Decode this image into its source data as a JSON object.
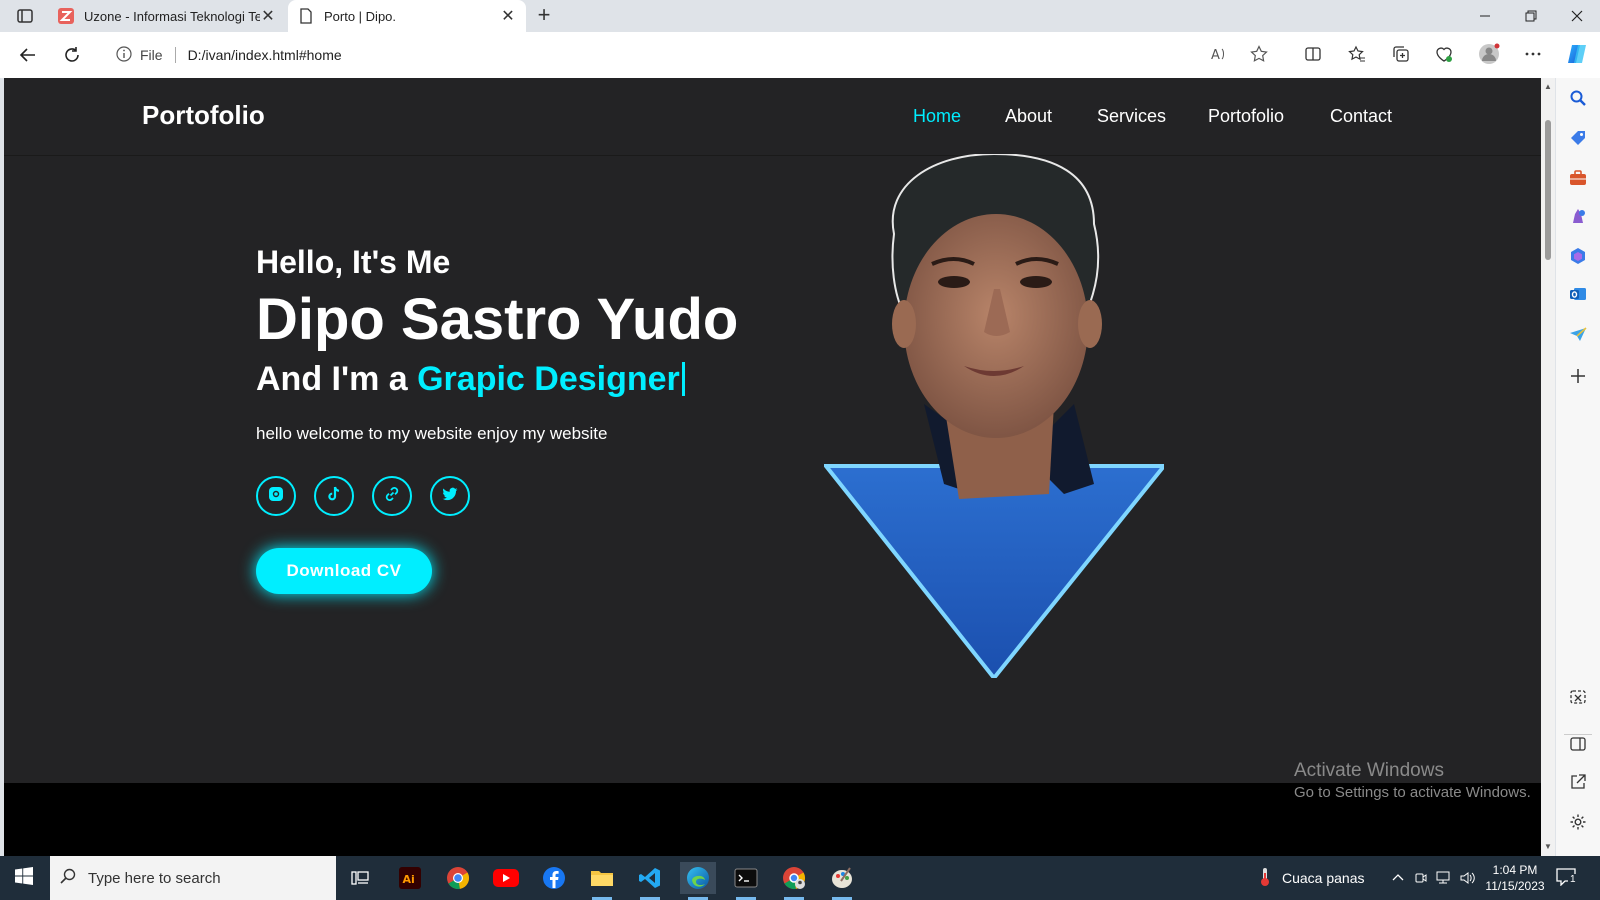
{
  "browser": {
    "tabs": [
      {
        "title": "Uzone - Informasi Teknologi Terk",
        "active": false
      },
      {
        "title": "Porto | Dipo.",
        "active": true
      }
    ],
    "address": {
      "scheme_label": "File",
      "url": "D:/ivan/index.html#home"
    }
  },
  "site": {
    "logo": "Portofolio",
    "nav": [
      {
        "label": "Home",
        "active": true
      },
      {
        "label": "About",
        "active": false
      },
      {
        "label": "Services",
        "active": false
      },
      {
        "label": "Portofolio",
        "active": false
      },
      {
        "label": "Contact",
        "active": false
      }
    ],
    "hero": {
      "greeting": "Hello, It's Me",
      "name": "Dipo Sastro Yudo",
      "role_prefix": "And I'm a",
      "role_highlight": "Grapic Designer",
      "tagline": "hello welcome to my website enjoy my website",
      "social_icons": [
        "instagram-icon",
        "tiktok-icon",
        "link-icon",
        "twitter-icon"
      ],
      "cta_label": "Download CV"
    },
    "accent_color": "#00eeff",
    "background_color": "#232325"
  },
  "os": {
    "watermark_title": "Activate Windows",
    "watermark_text": "Go to Settings to activate Windows.",
    "search_placeholder": "Type here to search",
    "weather": "Cuaca panas",
    "time": "1:04 PM",
    "date": "11/15/2023",
    "notification_count": "1"
  }
}
